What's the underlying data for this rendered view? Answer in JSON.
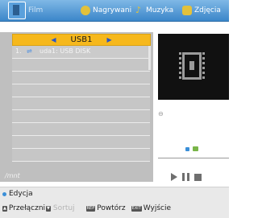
{
  "tabs": [
    {
      "label": "Film",
      "icon": "film-icon",
      "active": true
    },
    {
      "label": "Nagrywani",
      "icon": "record-icon"
    },
    {
      "label": "Muzyka",
      "icon": "music-note-icon"
    },
    {
      "label": "Zdjęcia",
      "icon": "photo-icon"
    }
  ],
  "device_selector": {
    "label": "USB1",
    "left_arrow": "◀",
    "right_arrow": "▶"
  },
  "file_list": [
    {
      "number": "1.",
      "icon": "usb-icon",
      "name": "uda1: USB DISK"
    }
  ],
  "path_label": "/mnt",
  "footer": {
    "edit_label": "Edycja",
    "switch_label": "Przełączni",
    "sort_label": "Sortuj",
    "repeat_label": "Powtórz",
    "exit_label": "Wyjście"
  },
  "colors": {
    "tab_bar": "#3b86c9",
    "selector_highlight": "#f6b81c",
    "list_background": "#c6c6c6",
    "preview_background": "#111111"
  }
}
